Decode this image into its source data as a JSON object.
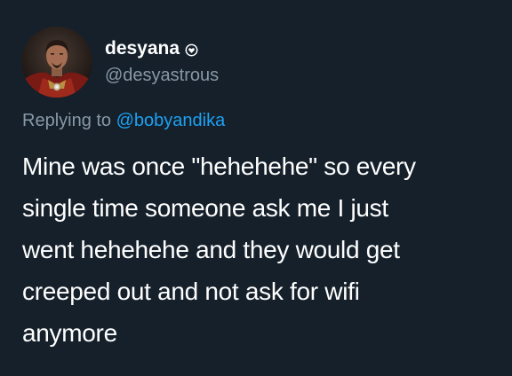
{
  "author": {
    "display_name": "desyana",
    "handle": "@desyastrous",
    "badge_icon": "heart-badge-icon"
  },
  "reply": {
    "prefix": "Replying to",
    "mention": "@bobyandika"
  },
  "tweet": {
    "lines": [
      "Mine was once \"hehehehe\" so every",
      "single time someone ask me I just",
      "went hehehehe and they would get",
      "creeped out and not ask for wifi",
      "anymore"
    ]
  },
  "colors": {
    "background": "#15202b",
    "text_primary": "#ffffff",
    "text_secondary": "#8899a6",
    "link": "#1da1f2"
  }
}
